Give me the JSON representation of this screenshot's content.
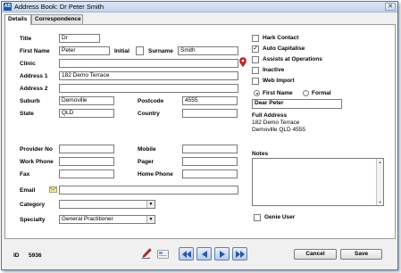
{
  "window": {
    "title": "Address Book: Dr Peter Smith",
    "app_icon": "AB",
    "close_glyph": "✕"
  },
  "tabs": [
    {
      "label": "Details",
      "active": true
    },
    {
      "label": "Correspondence",
      "active": false
    }
  ],
  "labels": {
    "title": "Title",
    "first_name": "First Name",
    "initial": "Initial",
    "surname": "Surname",
    "clinic": "Clinic",
    "address1": "Address 1",
    "address2": "Address 2",
    "suburb": "Suburb",
    "postcode": "Postcode",
    "state": "State",
    "country": "Country",
    "provider_no": "Provider No",
    "mobile": "Mobile",
    "work_phone": "Work Phone",
    "pager": "Pager",
    "fax": "Fax",
    "home_phone": "Home Phone",
    "email": "Email",
    "category": "Category",
    "specialty": "Specialty"
  },
  "fields": {
    "title": "Dr",
    "first_name": "Peter",
    "initial": "",
    "surname": "Smith",
    "clinic": "",
    "address1": "182 Demo Terrace",
    "address2": "",
    "suburb": "Demoville",
    "postcode": "4555",
    "state": "QLD",
    "country": "",
    "provider_no": "",
    "mobile": "",
    "work_phone": "",
    "pager": "",
    "fax": "",
    "home_phone": "",
    "email": "",
    "category": "",
    "specialty": "General Practitioner"
  },
  "options": {
    "hark_contact": {
      "label": "Hark Contact",
      "checked": false
    },
    "auto_capitalise": {
      "label": "Auto Capitalise",
      "checked": true
    },
    "assists_at_operations": {
      "label": "Assists at Operations",
      "checked": false
    },
    "inactive": {
      "label": "Inactive",
      "checked": false
    },
    "web_import": {
      "label": "Web Import",
      "checked": false
    },
    "genie_user": {
      "label": "Genie User",
      "checked": false
    }
  },
  "salutation": {
    "first_name_label": "First Name",
    "formal_label": "Formal",
    "selected": "first_name",
    "value": "Dear Peter"
  },
  "full_address": {
    "heading": "Full Address",
    "line1": "182 Demo Terrace",
    "line2": "Demoville QLD 4555"
  },
  "notes": {
    "heading": "Notes",
    "value": ""
  },
  "footer": {
    "id_label": "ID",
    "id_value": "5936",
    "cancel_label": "Cancel",
    "save_label": "Save"
  },
  "icons": {
    "map_pin": "location-pin-icon",
    "email": "email-icon",
    "pen": "pen-icon",
    "card": "card-icon",
    "check": "✓",
    "dropdown": "▼",
    "scroll_up": "▲",
    "scroll_down": "▼"
  },
  "colors": {
    "accent": "#1f55a8",
    "pin": "#d22020",
    "nav_button": "#b8cbe9"
  }
}
